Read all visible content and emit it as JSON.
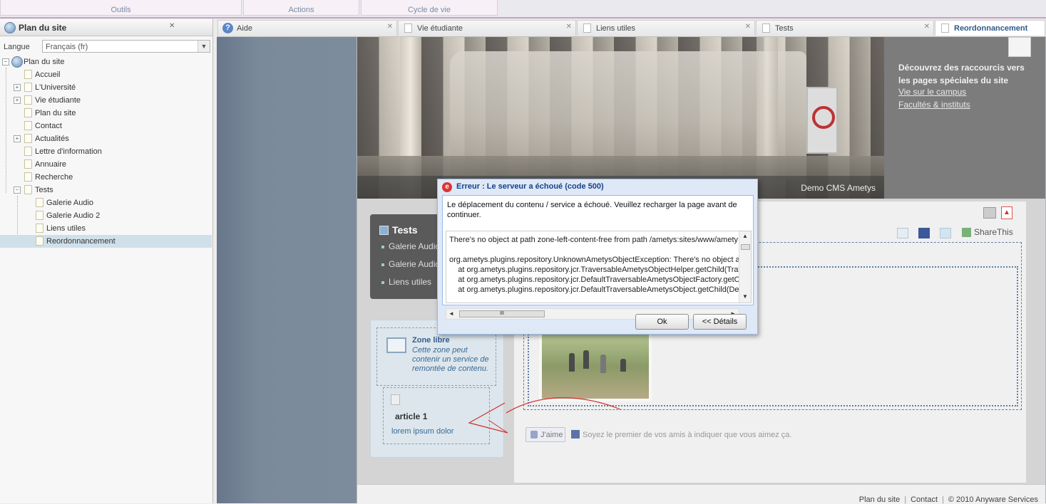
{
  "ribbon": {
    "groups": [
      "Outils",
      "Actions",
      "Cycle de vie"
    ]
  },
  "left_panel": {
    "title": "Plan du site",
    "close_glyph": "✕",
    "language_label": "Langue",
    "language_value": "Français (fr)",
    "tree": {
      "root": "Plan du site",
      "items": [
        {
          "label": "Accueil",
          "expandable": false
        },
        {
          "label": "L'Université",
          "expandable": true
        },
        {
          "label": "Vie étudiante",
          "expandable": true
        },
        {
          "label": "Plan du site",
          "expandable": false
        },
        {
          "label": "Contact",
          "expandable": false
        },
        {
          "label": "Actualités",
          "expandable": true
        },
        {
          "label": "Lettre d'information",
          "expandable": false
        },
        {
          "label": "Annuaire",
          "expandable": false
        },
        {
          "label": "Recherche",
          "expandable": false
        },
        {
          "label": "Tests",
          "expanded": true
        }
      ],
      "children": [
        "Galerie Audio",
        "Galerie Audio 2",
        "Liens utiles",
        "Reordonnancement"
      ],
      "selected": "Reordonnancement"
    }
  },
  "tabs": [
    {
      "label": "Aide",
      "icon": "help-icon"
    },
    {
      "label": "Vie étudiante",
      "icon": "page-icon"
    },
    {
      "label": "Liens utiles",
      "icon": "page-icon"
    },
    {
      "label": "Tests",
      "icon": "page-icon"
    },
    {
      "label": "Reordonnancement",
      "icon": "page-icon",
      "active": true
    }
  ],
  "hero": {
    "caption": "Demo CMS Ametys"
  },
  "quicklinks": {
    "heading": "Découvrez des raccourcis vers les pages spéciales du site",
    "links": [
      "Vie sur le campus",
      "Facultés & instituts"
    ]
  },
  "nav": {
    "title": "Tests",
    "items": [
      "Galerie Audio",
      "Galerie Audio",
      "Liens utiles"
    ]
  },
  "zone": {
    "title": "Zone libre",
    "description": "Cette zone peut contenir un service de remontée de contenu.",
    "article_title": "article 1",
    "article_text": "lorem ipsum dolor"
  },
  "share": {
    "label": "ShareThis"
  },
  "like": {
    "button": "J'aime",
    "text": "Soyez le premier de vos amis à indiquer que vous aimez ça."
  },
  "footer": {
    "links": [
      "Plan du site",
      "Contact",
      "© 2010 Anyware Services"
    ]
  },
  "dialog": {
    "title": "Erreur : Le serveur a échoué (code 500)",
    "message": "Le déplacement du contenu / service a échoué. Veuillez recharger la page avant de continuer.",
    "details_lines": [
      "There's no object at path zone-left-content-free from path /ametys:sites/www/amety",
      "",
      "org.ametys.plugins.repository.UnknownAmetysObjectException: There's no object at",
      "    at org.ametys.plugins.repository.jcr.TraversableAmetysObjectHelper.getChild(Trav",
      "    at org.ametys.plugins.repository.jcr.DefaultTraversableAmetysObjectFactory.getCl",
      "    at org.ametys.plugins.repository.jcr.DefaultTraversableAmetysObject.getChild(Defa"
    ],
    "ok_label": "Ok",
    "details_label": "<< Détails",
    "scroll_thumb_glyph": "III"
  },
  "colors": {
    "accent": "#15428b",
    "error": "#dd3333",
    "selected_row": "#cfe0ea"
  }
}
